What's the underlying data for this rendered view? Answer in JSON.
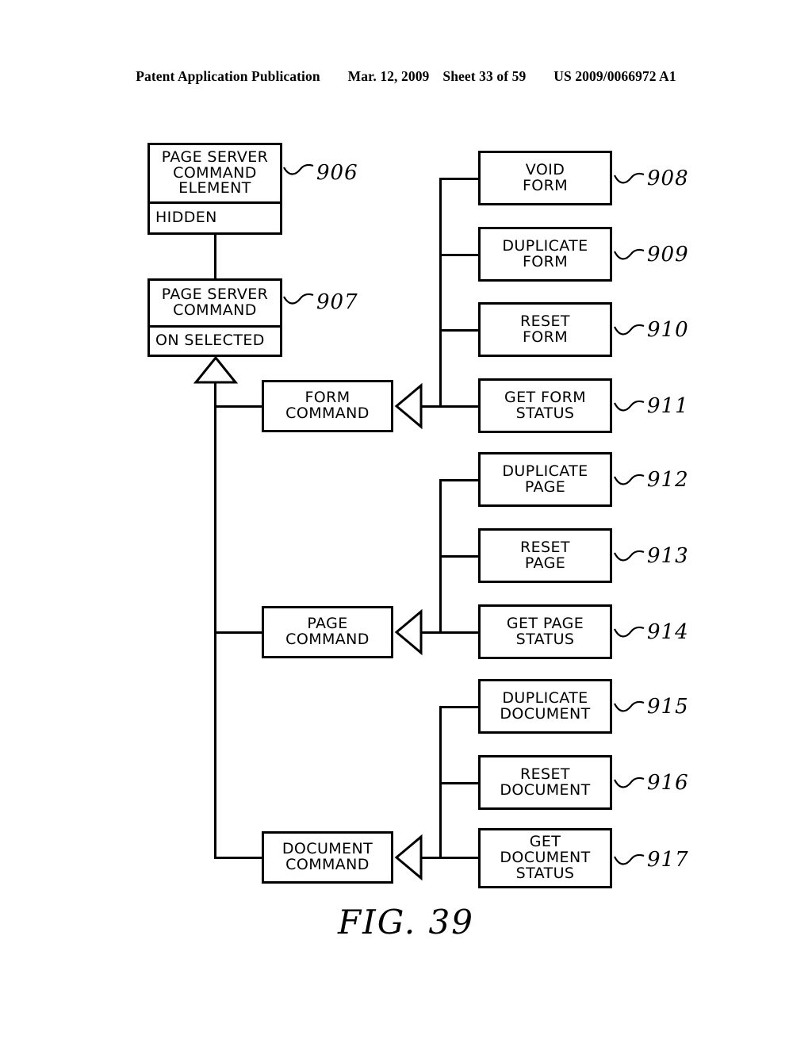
{
  "header": {
    "publication": "Patent Application Publication",
    "date": "Mar. 12, 2009",
    "sheet": "Sheet 33 of 59",
    "patent_number": "US 2009/0066972 A1"
  },
  "figure": {
    "caption": "FIG. 39"
  },
  "diagram": {
    "type": "uml-class-hierarchy",
    "classes": [
      {
        "id": "page-server-command-element",
        "name": "PAGE SERVER\nCOMMAND\nELEMENT",
        "attribute": "HIDDEN",
        "ref": "906"
      },
      {
        "id": "page-server-command",
        "name": "PAGE SERVER\nCOMMAND",
        "attribute": "ON SELECTED",
        "ref": "907"
      },
      {
        "id": "form-command",
        "name": "FORM\nCOMMAND",
        "attribute": null,
        "ref": null
      },
      {
        "id": "page-command",
        "name": "PAGE\nCOMMAND",
        "attribute": null,
        "ref": null
      },
      {
        "id": "document-command",
        "name": "DOCUMENT\nCOMMAND",
        "attribute": null,
        "ref": null
      }
    ],
    "leaves": [
      {
        "id": "void-form",
        "name": "VOID\nFORM",
        "ref": "908",
        "group": "form"
      },
      {
        "id": "duplicate-form",
        "name": "DUPLICATE\nFORM",
        "ref": "909",
        "group": "form"
      },
      {
        "id": "reset-form",
        "name": "RESET\nFORM",
        "ref": "910",
        "group": "form"
      },
      {
        "id": "get-form-status",
        "name": "GET FORM\nSTATUS",
        "ref": "911",
        "group": "form"
      },
      {
        "id": "duplicate-page",
        "name": "DUPLICATE\nPAGE",
        "ref": "912",
        "group": "page"
      },
      {
        "id": "reset-page",
        "name": "RESET\nPAGE",
        "ref": "913",
        "group": "page"
      },
      {
        "id": "get-page-status",
        "name": "GET PAGE\nSTATUS",
        "ref": "914",
        "group": "page"
      },
      {
        "id": "duplicate-document",
        "name": "DUPLICATE\nDOCUMENT",
        "ref": "915",
        "group": "document"
      },
      {
        "id": "reset-document",
        "name": "RESET\nDOCUMENT",
        "ref": "916",
        "group": "document"
      },
      {
        "id": "get-document-status",
        "name": "GET\nDOCUMENT\nSTATUS",
        "ref": "917",
        "group": "document"
      }
    ],
    "colors": {
      "stroke": "#000000",
      "fill": "#ffffff"
    }
  }
}
